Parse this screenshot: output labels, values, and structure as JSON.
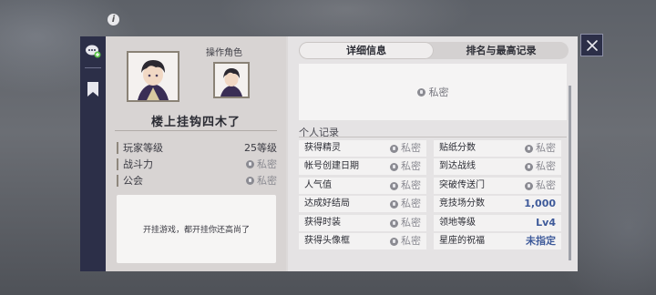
{
  "player": {
    "name": "楼上挂钩四木了",
    "operate_role_label": "操作角色"
  },
  "stats": [
    {
      "label": "玩家等级",
      "value": "25等级",
      "private": false
    },
    {
      "label": "战斗力",
      "value": "私密",
      "private": true
    },
    {
      "label": "公会",
      "value": "私密",
      "private": true
    }
  ],
  "bio": "开挂游戏，都开挂你还高尚了",
  "tabs": {
    "detail": "详细信息",
    "ranking": "排名与最高记录"
  },
  "detail_private_text": "私密",
  "section_title": "个人记录",
  "records_left": [
    {
      "label": "获得精灵",
      "value": "私密",
      "private": true
    },
    {
      "label": "帐号创建日期",
      "value": "私密",
      "private": true
    },
    {
      "label": "人气值",
      "value": "私密",
      "private": true
    },
    {
      "label": "达成好结局",
      "value": "私密",
      "private": true
    },
    {
      "label": "获得时装",
      "value": "私密",
      "private": true
    },
    {
      "label": "获得头像框",
      "value": "私密",
      "private": true
    }
  ],
  "records_right": [
    {
      "label": "贴纸分数",
      "value": "私密",
      "private": true
    },
    {
      "label": "到达战线",
      "value": "私密",
      "private": true
    },
    {
      "label": "突破传送门",
      "value": "私密",
      "private": true
    },
    {
      "label": "竞技场分数",
      "value": "1,000",
      "private": false
    },
    {
      "label": "领地等级",
      "value": "Lv4",
      "private": false
    },
    {
      "label": "星座的祝福",
      "value": "未指定",
      "private": false
    }
  ],
  "colors": {
    "sidebar": "#2c2f48",
    "panel": "#dcd9d9",
    "accent_value": "#3e5a9a"
  },
  "icons": [
    "info-icon",
    "chat-add-icon",
    "bookmark-icon",
    "lock-icon",
    "close-icon"
  ]
}
